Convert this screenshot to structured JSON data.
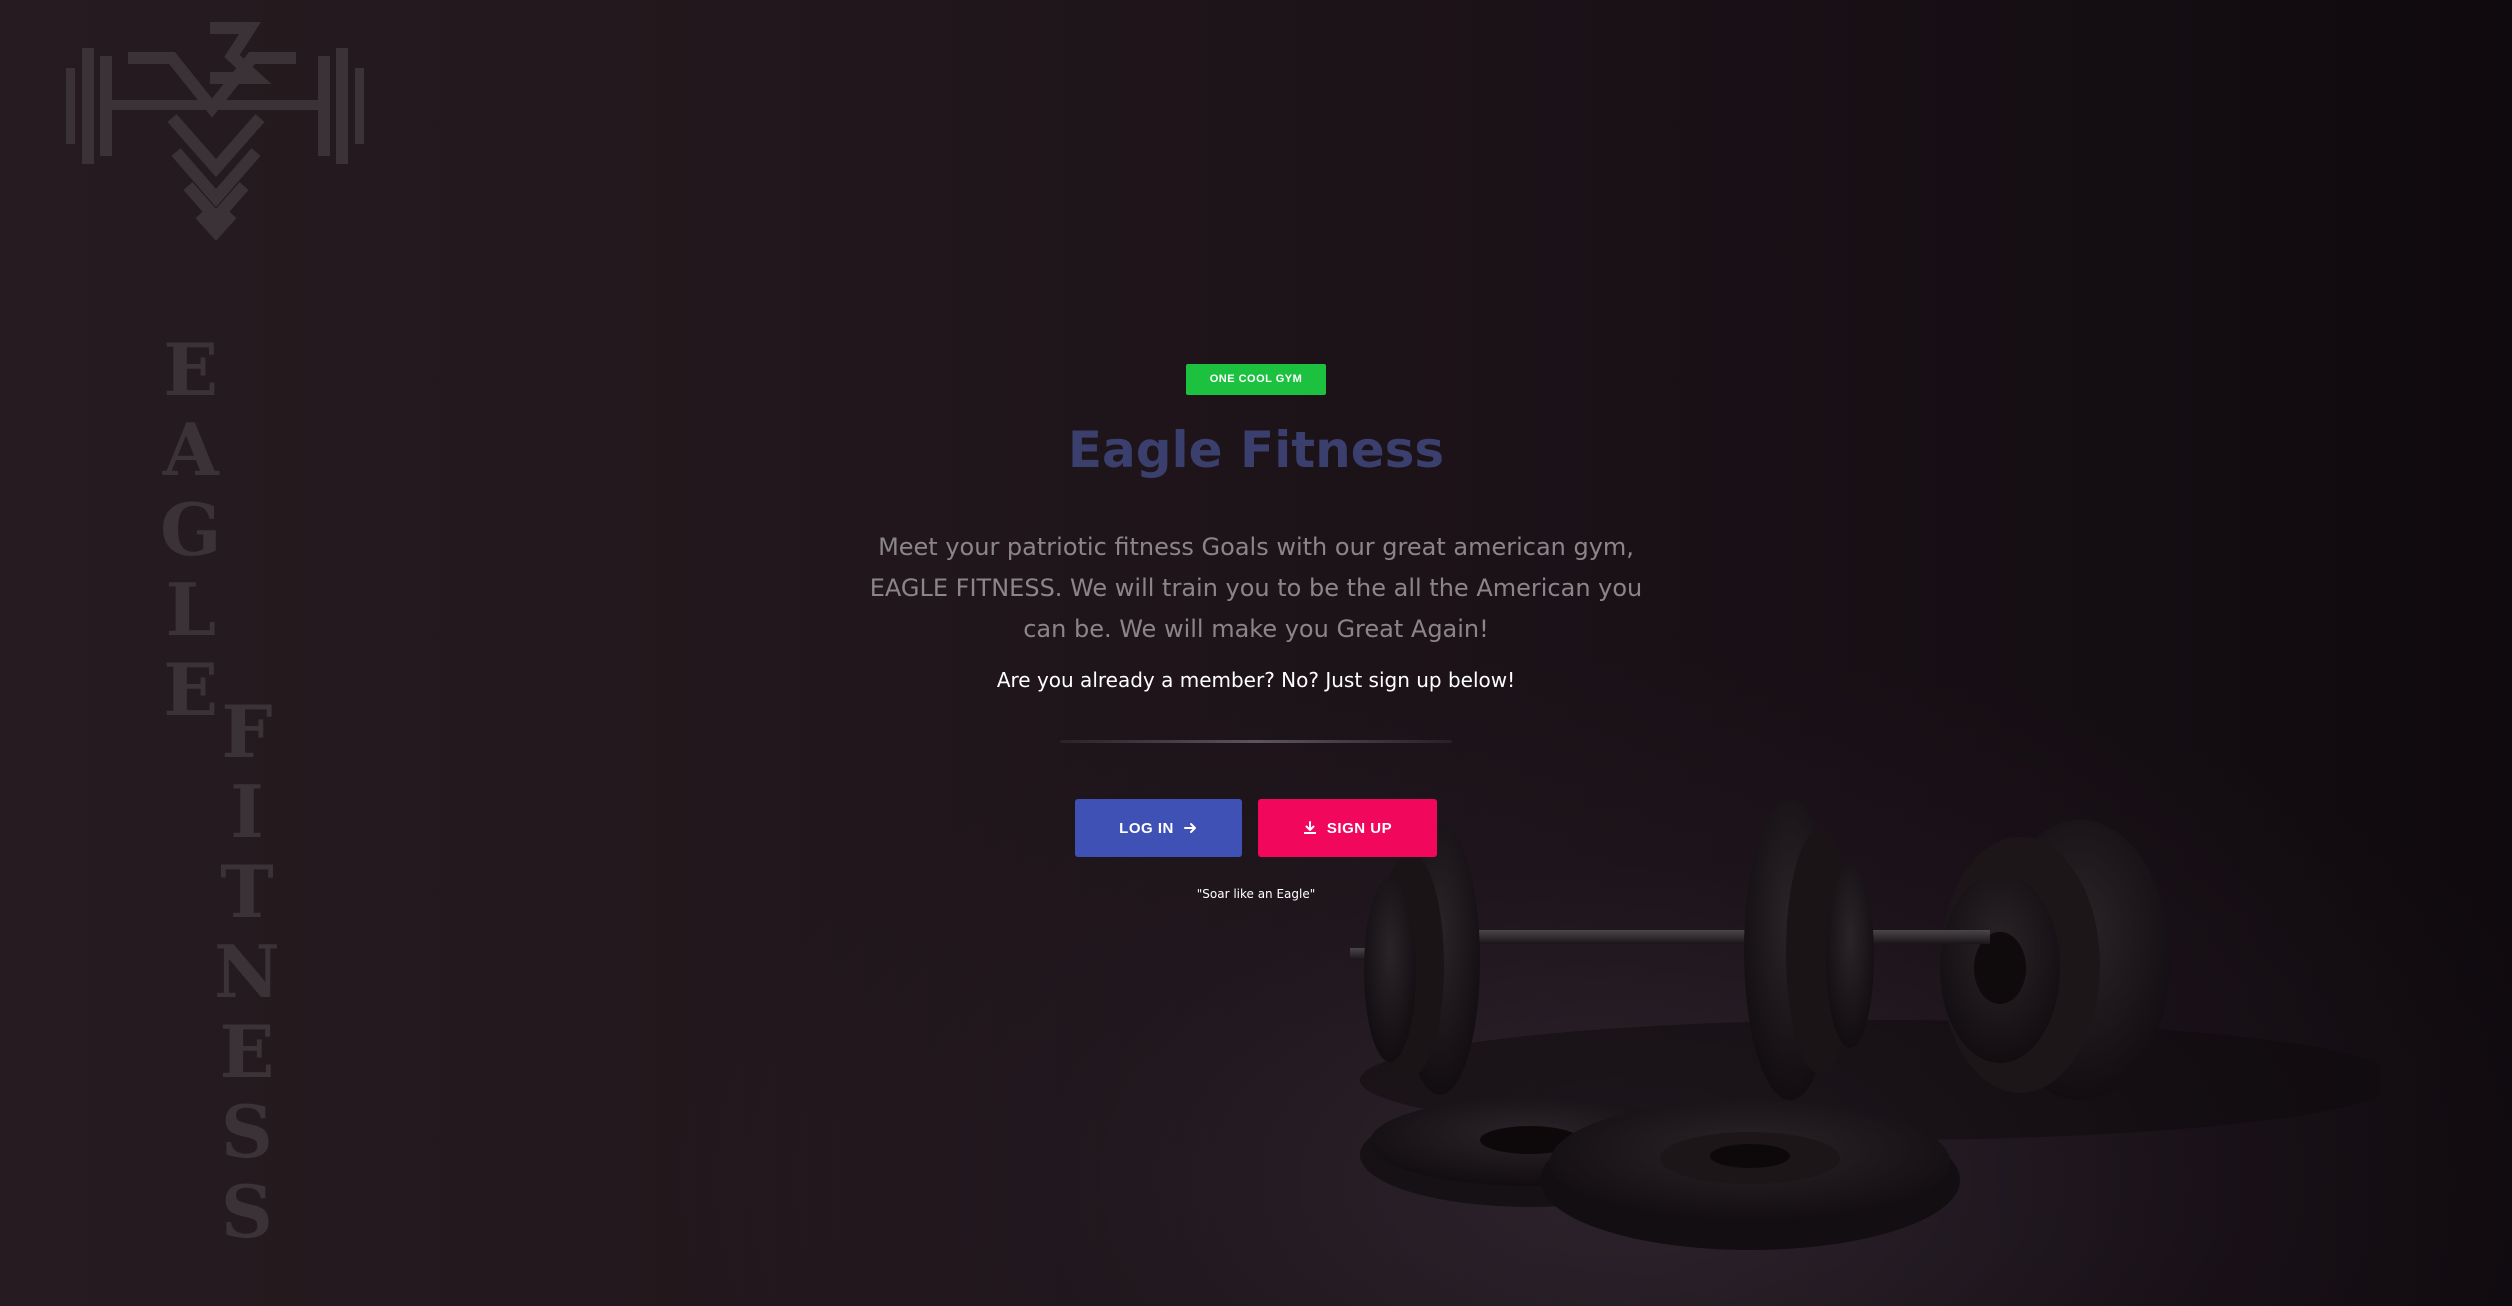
{
  "logo": {
    "word_top": [
      "E",
      "A",
      "G",
      "L",
      "E"
    ],
    "word_bottom": [
      "F",
      "I",
      "T",
      "N",
      "E",
      "S",
      "S"
    ]
  },
  "hero": {
    "badge": "ONE COOL GYM",
    "title": "Eagle Fitness",
    "description": "Meet your patriotic fitness Goals with our great american gym, EAGLE FITNESS. We will train you to be the all the American you can be. We will make you Great Again!",
    "subtitle": "Are you already a member? No? Just sign up below!",
    "login_label": "LOG IN",
    "signup_label": "SIGN UP",
    "motto": "\"Soar like an Eagle\""
  },
  "colors": {
    "badge": "#1cc13f",
    "login": "#3f51b5",
    "signup": "#f1085d",
    "title": "#3a3f6e"
  },
  "icons": {
    "login": "arrow-right-icon",
    "signup": "download-icon"
  }
}
